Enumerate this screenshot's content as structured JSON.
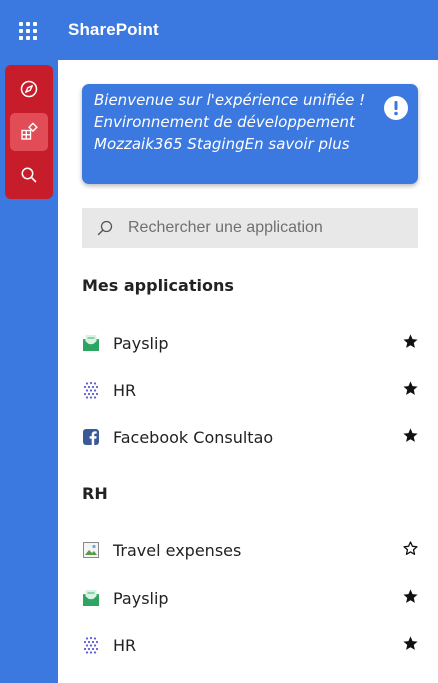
{
  "header": {
    "title": "SharePoint",
    "waffle_icon": "app-launcher-icon"
  },
  "rail": {
    "items": [
      {
        "name": "explore",
        "icon": "compass-icon",
        "active": false
      },
      {
        "name": "apps",
        "icon": "apps-grid-icon",
        "active": true
      },
      {
        "name": "search",
        "icon": "search-icon",
        "active": false
      }
    ],
    "color": "#c71c2a"
  },
  "banner": {
    "text": "Bienvenue sur l'expérience unifiée ! Environnement de développement Mozzaik365 StagingEn savoir plus",
    "icon": "alert-icon"
  },
  "search": {
    "placeholder": "Rechercher une application"
  },
  "sections": [
    {
      "title": "Mes applications",
      "items": [
        {
          "label": "Payslip",
          "icon": "payslip-icon",
          "favorite": true
        },
        {
          "label": "HR",
          "icon": "hr-dots-icon",
          "favorite": true
        },
        {
          "label": "Facebook Consultao",
          "icon": "facebook-icon",
          "favorite": true
        }
      ]
    },
    {
      "title": "RH",
      "items": [
        {
          "label": "Travel expenses",
          "icon": "image-placeholder-icon",
          "favorite": false
        },
        {
          "label": "Payslip",
          "icon": "payslip-icon",
          "favorite": true
        },
        {
          "label": "HR",
          "icon": "hr-dots-icon",
          "favorite": true
        }
      ]
    }
  ],
  "colors": {
    "brand_blue": "#3b78e0",
    "rail_red": "#c71c2a",
    "rail_active": "#e14c56"
  }
}
